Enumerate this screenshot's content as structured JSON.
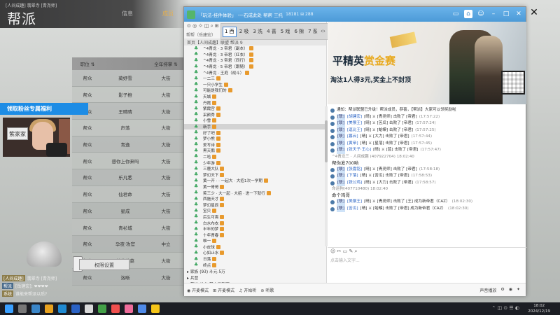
{
  "game": {
    "top_small": "[人间成趣] 翡翠寺 [青尧师]",
    "title": "帮派",
    "tabs": [
      "信息",
      "成员"
    ],
    "roster": {
      "headers": [
        "职位 ⇅",
        "",
        "全年排掌 ⇅"
      ],
      "rows": [
        [
          "帮众",
          "蔺妤雪",
          "大街"
        ],
        [
          "帮众",
          "影子橙",
          "大街"
        ],
        [
          "帮众",
          "王晴晴",
          "大街"
        ],
        [
          "帮众",
          "声落",
          "大街"
        ],
        [
          "帮众",
          "青逸",
          "大街"
        ],
        [
          "帮众",
          "想你上你来吗",
          "大街"
        ],
        [
          "帮众",
          "乐凡悉",
          "大街"
        ],
        [
          "帮众",
          "仙君命",
          "大街"
        ],
        [
          "帮众",
          "星成",
          "大街"
        ],
        [
          "帮众",
          "青衫城",
          "大街"
        ],
        [
          "帮众",
          "孕夜·攻官",
          "中立"
        ],
        [
          "帮众",
          "兼暮菜菜",
          "大街"
        ],
        [
          "帮众",
          "洛晰",
          "大街"
        ]
      ]
    },
    "fans_banner": "领取粉丝专属福利",
    "cam_label": "紫家家",
    "settings_button": "权限设置",
    "chat_lines": [
      {
        "tag": "[人间成趣]",
        "text": "翡翠寺 [青尧师]"
      },
      {
        "tag": "帮派",
        "text": "[岳建宏]: ❤❤❤❤"
      },
      {
        "tag": "系统",
        "text": "谁能来帮派以后?"
      }
    ]
  },
  "qq": {
    "title": "「玩法-挂件体验」 ·一石成此处 帮帮 三托",
    "meta": "18181  ⊞ 288",
    "ticker": [
      "1 西",
      "2 吸",
      "3 洗",
      "4 喜",
      "5 戏",
      "6 隙",
      "7 系"
    ],
    "left_tools": "⊙ ◎ ☼ ◫ ⌕ ⊞",
    "user_line": "帮帮（岳建宏）",
    "group_header": "首页【人间成趣】联盟  帮派 9",
    "members": [
      {
        "name": "^4青龙 · 3 帝君（副本）",
        "hl": false
      },
      {
        "name": "^4青龙 · 3 帝君（红衣）",
        "hl": false
      },
      {
        "name": "^4青龙 · 3 帝君（同行）",
        "hl": false
      },
      {
        "name": "^4青龙 · 5 帝君（跟随）",
        "hl": false
      },
      {
        "name": "^4青龙 · 王庭（战斗）",
        "hl": false
      },
      {
        "name": "一二三",
        "hl": false
      },
      {
        "name": "一只小学生",
        "hl": false
      },
      {
        "name": "可能是我们的",
        "hl": false
      },
      {
        "name": "天城",
        "hl": false
      },
      {
        "name": "丹霞",
        "hl": false
      },
      {
        "name": "紫霞宫",
        "hl": false
      },
      {
        "name": "采颜秀",
        "hl": false
      },
      {
        "name": "小雪",
        "hl": false
      },
      {
        "name": "新手",
        "hl": true
      },
      {
        "name": "好了吧",
        "hl": false
      },
      {
        "name": "梦小熊",
        "hl": false
      },
      {
        "name": "爱写诗",
        "hl": false
      },
      {
        "name": "黑天鹅",
        "hl": false
      },
      {
        "name": "二哈",
        "hl": false
      },
      {
        "name": "少年游",
        "hl": false
      },
      {
        "name": "三鹿大队",
        "hl": false
      },
      {
        "name": "梦幻天下",
        "hl": false
      },
      {
        "name": "黄一开 ·  · 一起大 · 大招1次一学期",
        "hl": false
      },
      {
        "name": "黄一哥哥",
        "hl": false
      },
      {
        "name": "笑三少 · 大一起 · 大招 · 进一下就行",
        "hl": false
      },
      {
        "name": "西施天才",
        "hl": false
      },
      {
        "name": "梦幻星辰",
        "hl": false
      },
      {
        "name": "宝贝",
        "hl": false
      },
      {
        "name": "后生可畏",
        "hl": false
      },
      {
        "name": "白水布衣",
        "hl": false
      },
      {
        "name": "半年的梦",
        "hl": false
      },
      {
        "name": "十年青春",
        "hl": false
      },
      {
        "name": "唯一",
        "hl": false
      },
      {
        "name": "小皮球",
        "hl": false
      },
      {
        "name": "心如止水",
        "hl": false
      },
      {
        "name": "日落",
        "hl": false
      },
      {
        "name": "终点",
        "hl": false
      }
    ],
    "groups": [
      "▸ 家族 (93) 斗元 5万",
      "▸ 兵营",
      "▸ 营地 (14) 帮宁贝联盟"
    ],
    "ad": {
      "title_a": "平精英",
      "title_b": "赏金赛",
      "subtitle": "淘汰1人得3元,奖金上不封顶"
    },
    "messages": [
      {
        "text": "通知：帮派联盟已升级！帮派成员，恭喜，【帮派】大家可以领奖励啦",
        "time": ""
      },
      {
        "tag": "[联]",
        "name": "[胡建宏]",
        "text": "[晴] ⚔ [青尧师] 击败了 [帝君]",
        "time": "(17:57:22)"
      },
      {
        "tag": "[联]",
        "name": "[美猴王]",
        "text": "[晴] ⚔ [苦瓜] 击败了 [帝君]",
        "time": "(17:57:24)"
      },
      {
        "tag": "[联]",
        "name": "[逗比王]",
        "text": "[晴] ⚔ [蛤蟆] 击败了 [帝君]",
        "time": "(17:57:25)"
      },
      {
        "tag": "[联]",
        "name": "[暮云]",
        "text": "[晴] ⚔ [大力] 击败了 [帝君]",
        "time": "(17:57:44)"
      },
      {
        "tag": "[联]",
        "name": "[黄帝]",
        "text": "[晴] ⚔ [星落] 击败了 [帝君]",
        "time": "(17:57:45)"
      },
      {
        "tag": "[联]",
        "name": "[张天子·王心]",
        "text": "[晴] ⚔ [蓝] 击败了 [帝君]",
        "time": "(17:57:47)"
      }
    ],
    "plain_1_meta": "^4青龙三 · 人间成趣 (407922704)  18:02:40",
    "plain_1": "帮你发700哟",
    "messages_2": [
      {
        "tag": "[联]",
        "name": "[张嘉铭]",
        "text": "[晴] ⚔ [青尧师] 击败了 [帝君]",
        "time": "(17:58:18)"
      },
      {
        "tag": "[联]",
        "name": "[下落]",
        "text": "[晴] ⚔ [苦瓜] 击败了 [帝君]",
        "time": "(17:58:53)"
      },
      {
        "tag": "[联]",
        "name": "[铁公鸡]",
        "text": "[晴] ⚔ [大力] 击败了 [帝君]",
        "time": "(17:58:57)"
      }
    ],
    "plain_2_meta": "命运狗(407710480)  18:02:40",
    "plain_2": "命个鸡哥",
    "messages_3": [
      {
        "tag": "[联]",
        "name": "[美猴王]",
        "text": "[晴] ⚔ [青尧师] 击败了 [王] 成为新帝君（CAZ）",
        "time": "(18:02:30)"
      },
      {
        "tag": "[联]",
        "name": "[苦瓜]",
        "text": "[晴] ⚔ [蛤蟆] 击败了 [帝君] 成为新帝君（CAZ）",
        "time": "(18:02:30)"
      }
    ],
    "input_toolbar": "☺ ✂ ▭ ✎ ⌕",
    "input_placeholder": "点击输入文字...",
    "bottom_left": [
      "◉ 开麦模式",
      "⊞ 开麦模式",
      "♫ 开始听",
      "⊜ 听歌"
    ],
    "bottom_right": [
      "声音播放",
      "⚙",
      "◉",
      "✦"
    ]
  },
  "taskbar": {
    "time": "18:02",
    "date": "2024/12/19",
    "tray": "⌃ ◫ ⊙ ☰ ◐"
  },
  "colors": {
    "qq_title": "#4c9ad7",
    "fans_banner": "#1d8ce5",
    "taskbar": "#1c1e24"
  }
}
